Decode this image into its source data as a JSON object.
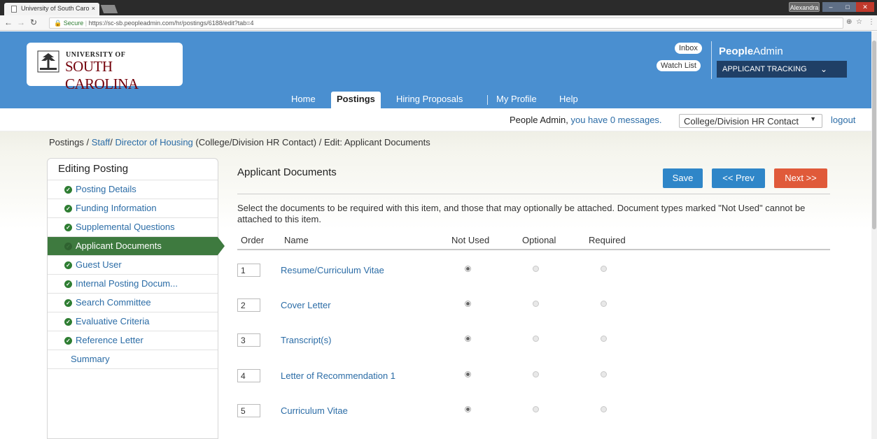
{
  "browser": {
    "tab_title": "University of South Caro",
    "tab_close": "×",
    "user_name": "Alexandra",
    "url_secure": "Secure",
    "url": "https://sc-sb.peopleadmin.com/hr/postings/6188/edit?tab=4"
  },
  "header": {
    "logo_line1": "UNIVERSITY OF",
    "logo_line2": "SOUTH CAROLINA",
    "inbox": "Inbox",
    "watch_list": "Watch List",
    "brand_people": "People",
    "brand_admin": "Admin",
    "module": "APPLICANT TRACKING",
    "nav": [
      "Home",
      "Postings",
      "Hiring Proposals",
      "My Profile",
      "Help"
    ]
  },
  "message_bar": {
    "prefix": "People Admin,",
    "link": "you have 0 messages.",
    "role": "College/Division HR Contact",
    "logout": "logout"
  },
  "breadcrumb": {
    "root": "Postings",
    "sep": "/",
    "staff": "Staff",
    "posting": "Director of Housing",
    "context": "(College/Division HR Contact)",
    "current": "Edit: Applicant Documents"
  },
  "sidebar": {
    "title": "Editing Posting",
    "items": [
      {
        "label": "Posting Details",
        "complete": true
      },
      {
        "label": "Funding Information",
        "complete": true
      },
      {
        "label": "Supplemental Questions",
        "complete": true
      },
      {
        "label": "Applicant Documents",
        "complete": true,
        "active": true
      },
      {
        "label": "Guest User",
        "complete": true
      },
      {
        "label": "Internal Posting Docum...",
        "complete": true
      },
      {
        "label": "Search Committee",
        "complete": true
      },
      {
        "label": "Evaluative Criteria",
        "complete": true
      },
      {
        "label": "Reference Letter",
        "complete": true
      },
      {
        "label": "Summary",
        "complete": false
      }
    ]
  },
  "main": {
    "title": "Applicant Documents",
    "buttons": {
      "save": "Save",
      "prev": "<< Prev",
      "next": "Next >>"
    },
    "instructions": "Select the documents to be required with this item, and those that may optionally be attached. Document types marked \"Not Used\" cannot be attached to this item.",
    "columns": {
      "order": "Order",
      "name": "Name",
      "not_used": "Not Used",
      "optional": "Optional",
      "required": "Required"
    },
    "documents": [
      {
        "order": "1",
        "name": "Resume/Curriculum Vitae",
        "selection": "Not Used"
      },
      {
        "order": "2",
        "name": "Cover Letter",
        "selection": "Not Used"
      },
      {
        "order": "3",
        "name": "Transcript(s)",
        "selection": "Not Used"
      },
      {
        "order": "4",
        "name": "Letter of Recommendation 1",
        "selection": "Not Used"
      },
      {
        "order": "5",
        "name": "Curriculum Vitae",
        "selection": "Not Used"
      }
    ]
  },
  "colors": {
    "header_blue": "#4a8fd0",
    "active_green": "#3e7a3f",
    "link_blue": "#2b6ca6",
    "button_blue": "#2f86c8",
    "button_orange": "#e05a3a",
    "usc_garnet": "#73000a"
  }
}
